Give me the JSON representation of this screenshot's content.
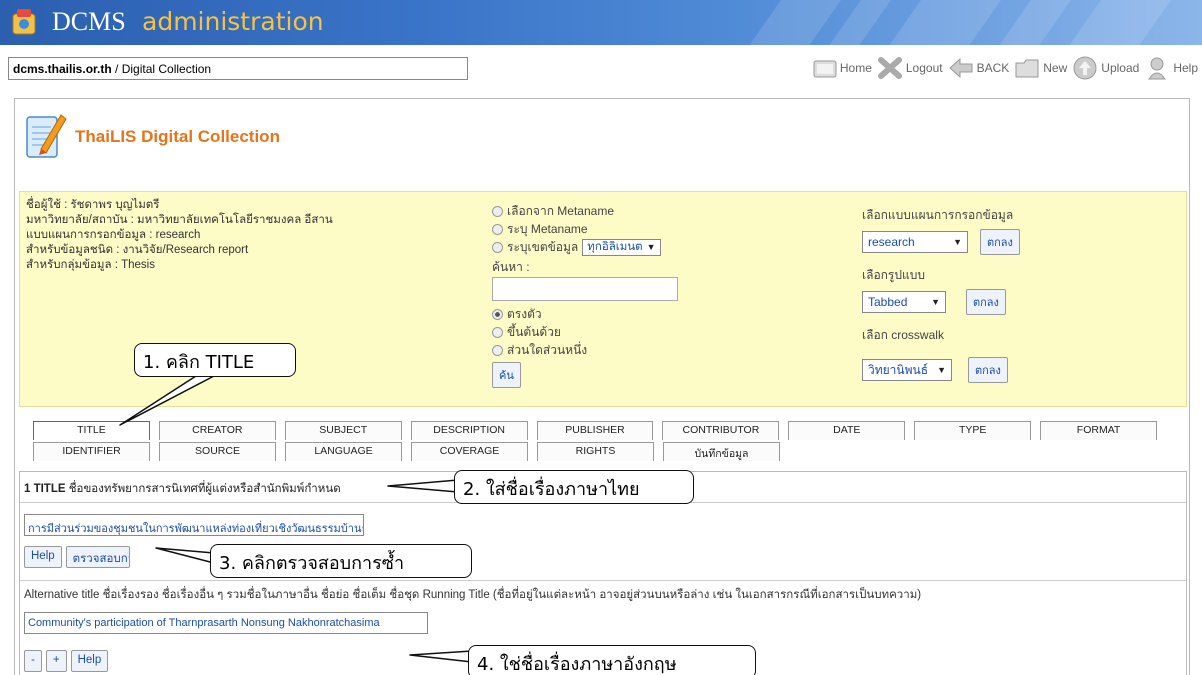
{
  "header": {
    "app_name": "DCMS",
    "app_subtitle": "administration",
    "address_domain": "dcms.thailis.or.th",
    "address_path": " / Digital Collection",
    "nav": [
      {
        "label": "Home",
        "icon": "home-icon"
      },
      {
        "label": "Logout",
        "icon": "logout-icon"
      },
      {
        "label": "BACK",
        "icon": "back-icon"
      },
      {
        "label": "New",
        "icon": "new-folder-icon"
      },
      {
        "label": "Upload",
        "icon": "upload-icon"
      },
      {
        "label": "Help",
        "icon": "help-icon"
      }
    ]
  },
  "brand": {
    "title": "ThaiLIS Digital Collection",
    "icon": "edit-document-icon"
  },
  "user_info": [
    "ชื่อผู้ใช้ : รัชดาพร บุญไมตรี",
    "มหาวิทยาลัย/สถาบัน : มหาวิทยาลัยเทคโนโลยีราชมงคล อีสาน",
    "แบบแผนการกรอกข้อมูล : research",
    "สำหรับข้อมูลชนิด : งานวิจัย/Research report",
    "สำหรับกลุ่มข้อมูล : Thesis"
  ],
  "search": {
    "option_metaname_select": "เลือกจาก Metaname",
    "option_metaname_specify": "ระบุ Metaname",
    "option_scope": "ระบุเขตข้อมูล",
    "scope_select": "ทุกอิลิเมนต",
    "search_label": "ค้นหา :",
    "search_value": "",
    "match_exact": "ตรงตัว",
    "match_starts": "ขึ้นต้นด้วย",
    "match_part": "ส่วนใดส่วนหนึ่ง",
    "search_button": "ค้น"
  },
  "form_select": {
    "template_label": "เลือกแบบแผนการกรอกข้อมูล",
    "template_value": "research",
    "layout_label": "เลือกรูปแบบ",
    "layout_value": "Tabbed",
    "crosswalk_label": "เลือก crosswalk",
    "crosswalk_value": "วิทยานิพนธ์",
    "ok_label": "ตกลง"
  },
  "tabs": {
    "row1": [
      "TITLE",
      "CREATOR",
      "SUBJECT",
      "DESCRIPTION",
      "PUBLISHER",
      "CONTRIBUTOR",
      "DATE",
      "TYPE",
      "FORMAT"
    ],
    "row2": [
      "IDENTIFIER",
      "SOURCE",
      "LANGUAGE",
      "COVERAGE",
      "RIGHTS",
      "บันทึกข้อมูล"
    ],
    "active": "TITLE"
  },
  "title_field": {
    "number": "1 TITLE",
    "description": " ชื่อของทรัพยากรสารนิเทศที่ผู้แต่งหรือสำนักพิมพ์กำหนด",
    "value": "การมีส่วนร่วมของชุมชนในการพัฒนาแหล่งท่องเที่ยวเชิงวัฒนธรรมบ้านธารปราสาท อำเภอโนนสูง จังหวัดน",
    "help_label": "Help",
    "check_label": "ตรวจสอบการซ้ำ"
  },
  "alt_title_field": {
    "label": "Alternative title ชื่อเรื่องรอง ชื่อเรื่องอื่น ๆ รวมชื่อในภาษาอื่น ชื่อย่อ ชื่อเต็ม ชื่อชุด Running Title (ชื่อที่อยู่ในแต่ละหน้า อาจอยู่ส่วนบนหรือล่าง เช่น ในเอกสารกรณีที่เอกสารเป็นบทความ)",
    "value": "Community's participation of Tharnprasarth Nonsung Nakhonratchasima",
    "minus_label": "-",
    "plus_label": "+",
    "help_label": "Help"
  },
  "callouts": {
    "c1": "1. คลิก TITLE",
    "c2": "2. ใส่ชื่อเรื่องภาษาไทย",
    "c3": "3. คลิกตรวจสอบการซ้ำ",
    "c4": "4. ใช่ชื่อเรื่องภาษาอังกฤษ"
  },
  "colors": {
    "banner": "#3a74c8",
    "brand_title": "#e6741a",
    "info_bg": "#fdfbc6",
    "link_blue": "#1b4ea8"
  }
}
